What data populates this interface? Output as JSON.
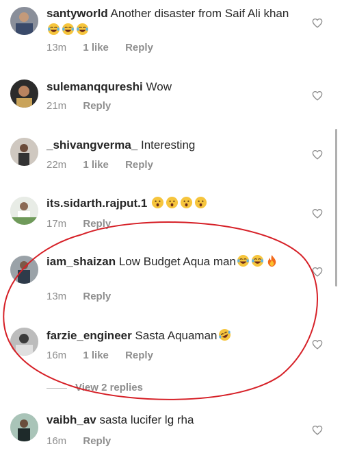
{
  "comments": [
    {
      "username": "santyworld",
      "text": "Another disaster from Saif Ali khan",
      "emojis": [
        "laughing-tears",
        "laughing-tears",
        "laughing-tears"
      ],
      "time": "13m",
      "likes": "1 like",
      "reply": "Reply"
    },
    {
      "username": "sulemanqqureshi",
      "text": "Wow",
      "emojis": [],
      "time": "21m",
      "likes": "",
      "reply": "Reply"
    },
    {
      "username": "_shivangverma_",
      "text": "Interesting",
      "emojis": [],
      "time": "22m",
      "likes": "1 like",
      "reply": "Reply"
    },
    {
      "username": "its.sidarth.rajput.1",
      "text": "",
      "emojis": [
        "surprised",
        "surprised",
        "surprised",
        "surprised"
      ],
      "time": "17m",
      "likes": "",
      "reply": "Reply"
    },
    {
      "username": "iam_shaizan",
      "text": "Low Budget Aqua man",
      "emojis": [
        "laughing-tears",
        "laughing-tears",
        "fire"
      ],
      "time": "13m",
      "likes": "",
      "reply": "Reply"
    },
    {
      "username": "farzie_engineer",
      "text": "Sasta Aquaman",
      "emojis": [
        "rofl"
      ],
      "time": "16m",
      "likes": "1 like",
      "reply": "Reply"
    },
    {
      "username": "vaibh_av",
      "text": "sasta lucifer lg rha",
      "emojis": [],
      "time": "16m",
      "likes": "",
      "reply": "Reply"
    }
  ],
  "view_replies": "View 2 replies",
  "icons": {
    "like": "heart-outline-icon"
  },
  "colors": {
    "text": "#262626",
    "meta": "#8e8e8e",
    "highlight": "#d62027"
  }
}
